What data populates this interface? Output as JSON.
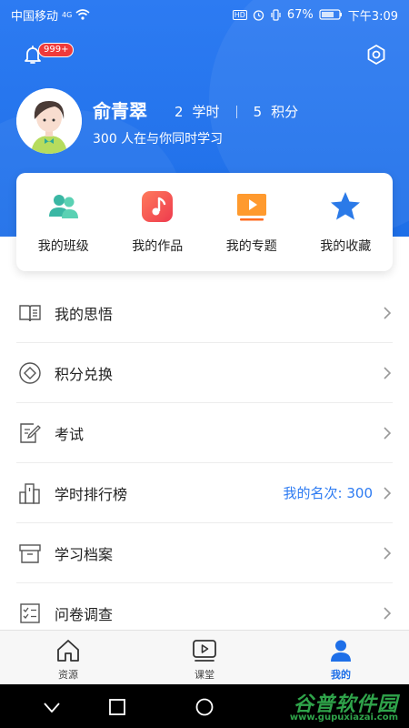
{
  "status_bar": {
    "carrier": "中国移动",
    "network": "4G",
    "battery": "67%",
    "time": "下午3:09"
  },
  "header": {
    "notifications_badge": "999+",
    "user": {
      "name": "俞青翠",
      "hours_value": "2",
      "hours_label": "学时",
      "points_value": "5",
      "points_label": "积分",
      "subtitle": "300 人在与你同时学习"
    }
  },
  "quick_actions": [
    {
      "label": "我的班级",
      "icon": "class-group-icon"
    },
    {
      "label": "我的作品",
      "icon": "music-note-icon"
    },
    {
      "label": "我的专题",
      "icon": "play-video-icon"
    },
    {
      "label": "我的收藏",
      "icon": "star-icon"
    }
  ],
  "menu": [
    {
      "label": "我的思悟",
      "icon": "book-icon",
      "extra": ""
    },
    {
      "label": "积分兑换",
      "icon": "exchange-icon",
      "extra": ""
    },
    {
      "label": "考试",
      "icon": "exam-edit-icon",
      "extra": ""
    },
    {
      "label": "学时排行榜",
      "icon": "ranking-icon",
      "extra": "我的名次: 300"
    },
    {
      "label": "学习档案",
      "icon": "archive-box-icon",
      "extra": ""
    },
    {
      "label": "问卷调查",
      "icon": "survey-checklist-icon",
      "extra": ""
    }
  ],
  "tabs": [
    {
      "label": "资源",
      "icon": "home-icon",
      "active": false
    },
    {
      "label": "课堂",
      "icon": "video-class-icon",
      "active": false
    },
    {
      "label": "我的",
      "icon": "person-icon",
      "active": true
    }
  ],
  "watermark": {
    "text": "谷普软件园",
    "url": "www.gupuxiazai.com"
  },
  "colors": {
    "brand_blue": "#1e6fe8",
    "badge_red": "#f03a3a",
    "watermark_green": "#2fa34a"
  }
}
